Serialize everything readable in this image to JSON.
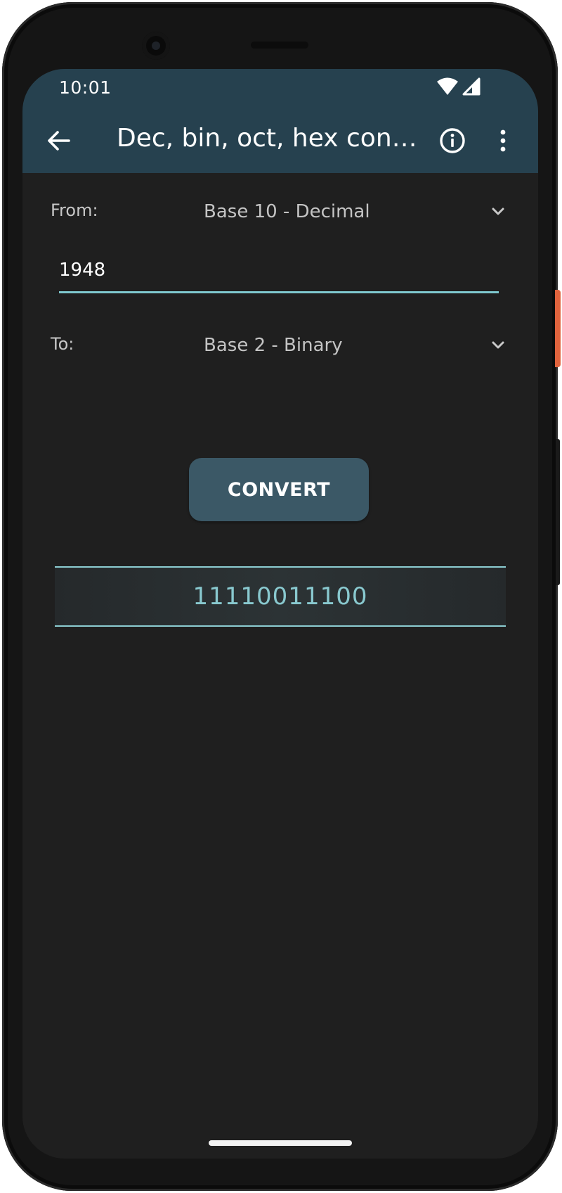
{
  "status_bar": {
    "time": "10:01",
    "wifi_icon": "wifi-icon",
    "signal_icon": "cell-signal-icon"
  },
  "app_bar": {
    "back_icon": "arrow-back-icon",
    "title": "Dec, bin, oct, hex conve...",
    "info_icon": "info-icon",
    "more_icon": "more-vert-icon"
  },
  "form": {
    "from_label": "From:",
    "from_value": "Base 10 - Decimal",
    "input_value": "1948",
    "to_label": "To:",
    "to_value": "Base 2 - Binary",
    "convert_label": "CONVERT",
    "result": "11110011100"
  },
  "colors": {
    "app_bar": "#26414f",
    "background": "#1f1f1f",
    "accent": "#7fc8cf",
    "button": "#3b5866"
  }
}
